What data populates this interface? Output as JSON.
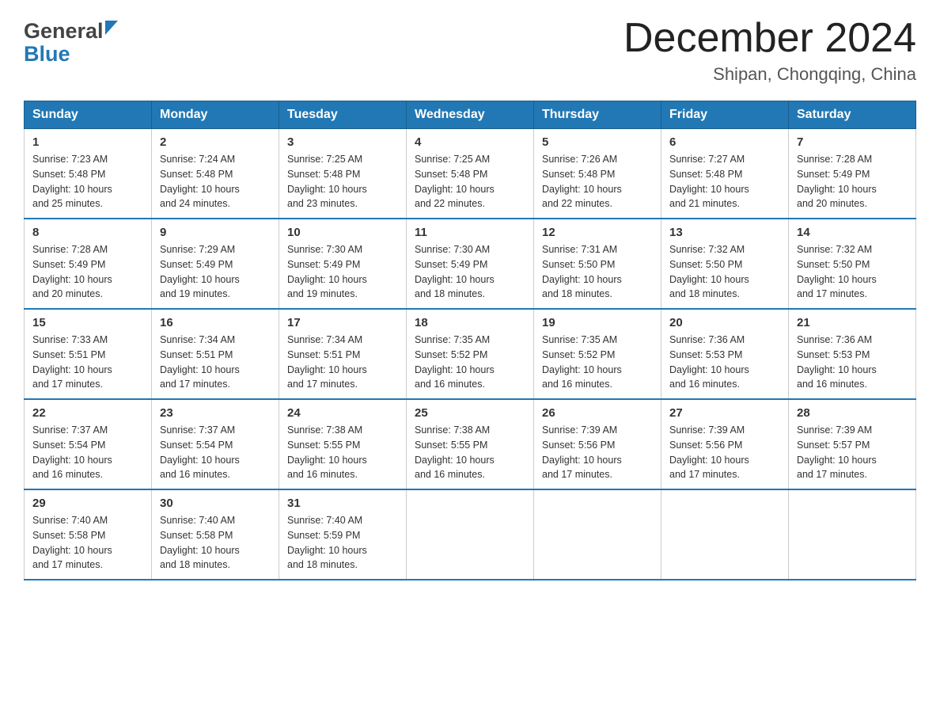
{
  "logo": {
    "general": "General",
    "blue": "Blue"
  },
  "header": {
    "title": "December 2024",
    "subtitle": "Shipan, Chongqing, China"
  },
  "columns": [
    "Sunday",
    "Monday",
    "Tuesday",
    "Wednesday",
    "Thursday",
    "Friday",
    "Saturday"
  ],
  "weeks": [
    [
      {
        "day": "1",
        "sunrise": "7:23 AM",
        "sunset": "5:48 PM",
        "daylight": "10 hours and 25 minutes."
      },
      {
        "day": "2",
        "sunrise": "7:24 AM",
        "sunset": "5:48 PM",
        "daylight": "10 hours and 24 minutes."
      },
      {
        "day": "3",
        "sunrise": "7:25 AM",
        "sunset": "5:48 PM",
        "daylight": "10 hours and 23 minutes."
      },
      {
        "day": "4",
        "sunrise": "7:25 AM",
        "sunset": "5:48 PM",
        "daylight": "10 hours and 22 minutes."
      },
      {
        "day": "5",
        "sunrise": "7:26 AM",
        "sunset": "5:48 PM",
        "daylight": "10 hours and 22 minutes."
      },
      {
        "day": "6",
        "sunrise": "7:27 AM",
        "sunset": "5:48 PM",
        "daylight": "10 hours and 21 minutes."
      },
      {
        "day": "7",
        "sunrise": "7:28 AM",
        "sunset": "5:49 PM",
        "daylight": "10 hours and 20 minutes."
      }
    ],
    [
      {
        "day": "8",
        "sunrise": "7:28 AM",
        "sunset": "5:49 PM",
        "daylight": "10 hours and 20 minutes."
      },
      {
        "day": "9",
        "sunrise": "7:29 AM",
        "sunset": "5:49 PM",
        "daylight": "10 hours and 19 minutes."
      },
      {
        "day": "10",
        "sunrise": "7:30 AM",
        "sunset": "5:49 PM",
        "daylight": "10 hours and 19 minutes."
      },
      {
        "day": "11",
        "sunrise": "7:30 AM",
        "sunset": "5:49 PM",
        "daylight": "10 hours and 18 minutes."
      },
      {
        "day": "12",
        "sunrise": "7:31 AM",
        "sunset": "5:50 PM",
        "daylight": "10 hours and 18 minutes."
      },
      {
        "day": "13",
        "sunrise": "7:32 AM",
        "sunset": "5:50 PM",
        "daylight": "10 hours and 18 minutes."
      },
      {
        "day": "14",
        "sunrise": "7:32 AM",
        "sunset": "5:50 PM",
        "daylight": "10 hours and 17 minutes."
      }
    ],
    [
      {
        "day": "15",
        "sunrise": "7:33 AM",
        "sunset": "5:51 PM",
        "daylight": "10 hours and 17 minutes."
      },
      {
        "day": "16",
        "sunrise": "7:34 AM",
        "sunset": "5:51 PM",
        "daylight": "10 hours and 17 minutes."
      },
      {
        "day": "17",
        "sunrise": "7:34 AM",
        "sunset": "5:51 PM",
        "daylight": "10 hours and 17 minutes."
      },
      {
        "day": "18",
        "sunrise": "7:35 AM",
        "sunset": "5:52 PM",
        "daylight": "10 hours and 16 minutes."
      },
      {
        "day": "19",
        "sunrise": "7:35 AM",
        "sunset": "5:52 PM",
        "daylight": "10 hours and 16 minutes."
      },
      {
        "day": "20",
        "sunrise": "7:36 AM",
        "sunset": "5:53 PM",
        "daylight": "10 hours and 16 minutes."
      },
      {
        "day": "21",
        "sunrise": "7:36 AM",
        "sunset": "5:53 PM",
        "daylight": "10 hours and 16 minutes."
      }
    ],
    [
      {
        "day": "22",
        "sunrise": "7:37 AM",
        "sunset": "5:54 PM",
        "daylight": "10 hours and 16 minutes."
      },
      {
        "day": "23",
        "sunrise": "7:37 AM",
        "sunset": "5:54 PM",
        "daylight": "10 hours and 16 minutes."
      },
      {
        "day": "24",
        "sunrise": "7:38 AM",
        "sunset": "5:55 PM",
        "daylight": "10 hours and 16 minutes."
      },
      {
        "day": "25",
        "sunrise": "7:38 AM",
        "sunset": "5:55 PM",
        "daylight": "10 hours and 16 minutes."
      },
      {
        "day": "26",
        "sunrise": "7:39 AM",
        "sunset": "5:56 PM",
        "daylight": "10 hours and 17 minutes."
      },
      {
        "day": "27",
        "sunrise": "7:39 AM",
        "sunset": "5:56 PM",
        "daylight": "10 hours and 17 minutes."
      },
      {
        "day": "28",
        "sunrise": "7:39 AM",
        "sunset": "5:57 PM",
        "daylight": "10 hours and 17 minutes."
      }
    ],
    [
      {
        "day": "29",
        "sunrise": "7:40 AM",
        "sunset": "5:58 PM",
        "daylight": "10 hours and 17 minutes."
      },
      {
        "day": "30",
        "sunrise": "7:40 AM",
        "sunset": "5:58 PM",
        "daylight": "10 hours and 18 minutes."
      },
      {
        "day": "31",
        "sunrise": "7:40 AM",
        "sunset": "5:59 PM",
        "daylight": "10 hours and 18 minutes."
      },
      null,
      null,
      null,
      null
    ]
  ],
  "labels": {
    "sunrise": "Sunrise:",
    "sunset": "Sunset:",
    "daylight": "Daylight:"
  }
}
